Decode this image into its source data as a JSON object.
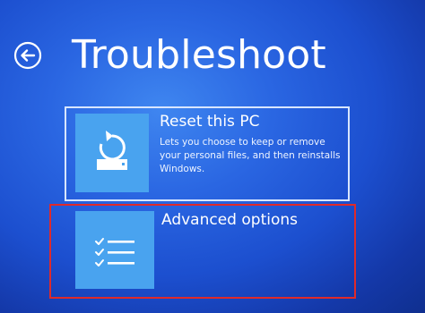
{
  "header": {
    "title": "Troubleshoot",
    "back_icon": "back-arrow-icon"
  },
  "options": [
    {
      "title": "Reset this PC",
      "description": "Lets you choose to keep or remove your personal files, and then reinstalls Windows.",
      "icon": "reset-pc-icon"
    },
    {
      "title": "Advanced options",
      "icon": "checklist-icon",
      "highlighted": true
    }
  ],
  "colors": {
    "background": "#2a66e2",
    "tile": "#49a3ef",
    "highlight_outline": "#e02a2a",
    "text": "#ffffff"
  }
}
